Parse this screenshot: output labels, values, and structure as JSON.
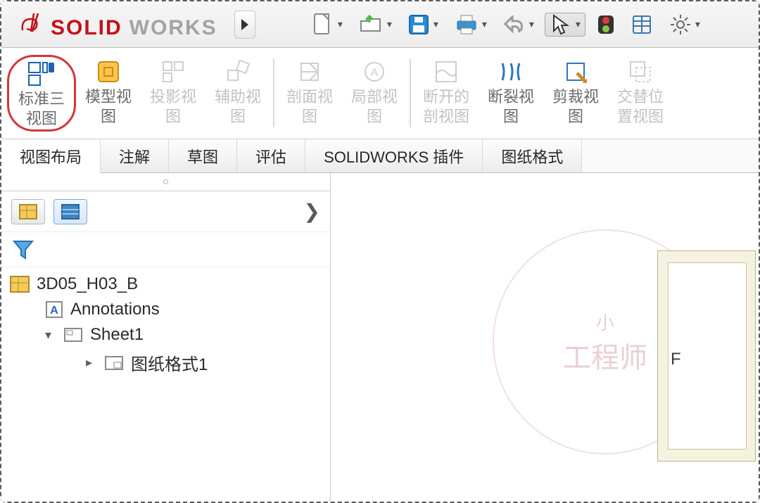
{
  "brand": {
    "solid": "SOLID",
    "works": "WORKS"
  },
  "ribbon": [
    {
      "id": "std3",
      "label": "标准三\n视图"
    },
    {
      "id": "model",
      "label": "模型视\n图"
    },
    {
      "id": "proj",
      "label": "投影视\n图"
    },
    {
      "id": "aux",
      "label": "辅助视\n图"
    },
    {
      "id": "section",
      "label": "剖面视\n图"
    },
    {
      "id": "detail",
      "label": "局部视\n图"
    },
    {
      "id": "broken",
      "label": "断开的\n剖视图"
    },
    {
      "id": "break",
      "label": "断裂视\n图"
    },
    {
      "id": "crop",
      "label": "剪裁视\n图"
    },
    {
      "id": "altpos",
      "label": "交替位\n置视图"
    }
  ],
  "tabs": [
    {
      "label": "视图布局",
      "active": true
    },
    {
      "label": "注解"
    },
    {
      "label": "草图"
    },
    {
      "label": "评估"
    },
    {
      "label": "SOLIDWORKS 插件"
    },
    {
      "label": "图纸格式"
    }
  ],
  "tree": {
    "root": "3D05_H03_B",
    "annotations": "Annotations",
    "sheet": "Sheet1",
    "sheet_format": "图纸格式1"
  },
  "sheet_label": "F",
  "watermark": {
    "small": "小",
    "main": "工程师"
  }
}
